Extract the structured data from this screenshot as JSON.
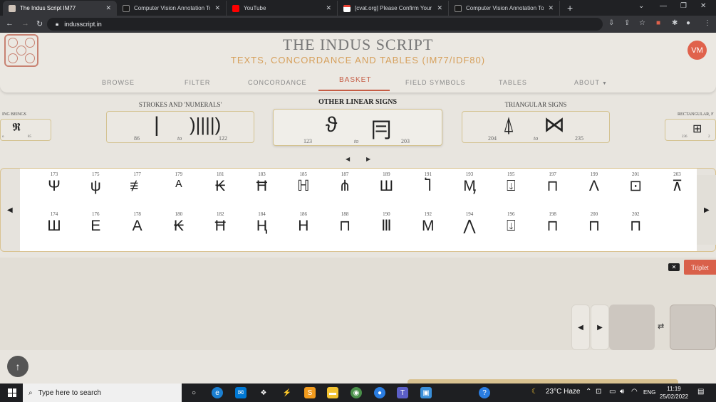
{
  "browser": {
    "tabs": [
      {
        "title": "The Indus Script IM77",
        "active": true,
        "favicon_color": "#cfc3b8"
      },
      {
        "title": "Computer Vision Annotation Too",
        "active": false,
        "favicon_color": "#1a1a1a"
      },
      {
        "title": "YouTube",
        "active": false,
        "favicon_color": "#ff0000"
      },
      {
        "title": "[cvat.org] Please Confirm Your E-",
        "active": false,
        "favicon_color": "#ffffff"
      },
      {
        "title": "Computer Vision Annotation Too",
        "active": false,
        "favicon_color": "#1a1a1a"
      }
    ],
    "close_glyph": "✕",
    "new_tab_glyph": "+",
    "url": "indusscript.in"
  },
  "site": {
    "title": "THE INDUS SCRIPT",
    "subtitle": "TEXTS, CONCORDANCE AND TABLES (IM77/IDF80)",
    "avatar_initials": "VM",
    "menu": [
      "BROWSE",
      "FILTER",
      "CONCORDANCE",
      "BASKET",
      "FIELD SYMBOLS",
      "TABLES",
      "ABOUT"
    ],
    "active_menu": "BASKET",
    "accent": "#c55c44"
  },
  "categories": {
    "left_partial": {
      "title": "ING BEINGS",
      "from": "o",
      "to": "85"
    },
    "strokes": {
      "title": "STROKES AND 'NUMERALS'",
      "from": "86",
      "to_word": "to",
      "to": "122"
    },
    "linear": {
      "title": "OTHER LINEAR SIGNS",
      "from": "123",
      "to_word": "to",
      "to": "203"
    },
    "triangular": {
      "title": "TRIANGULAR SIGNS",
      "from": "204",
      "to_word": "to",
      "to": "235"
    },
    "right_partial": {
      "title": "RECTANGULAR, F",
      "from": "236",
      "to": "2"
    }
  },
  "signs_top": [
    "173",
    "175",
    "177",
    "179",
    "181",
    "183",
    "185",
    "187",
    "189",
    "191",
    "193",
    "195",
    "197",
    "199",
    "201",
    "203"
  ],
  "signs_bottom": [
    "174",
    "176",
    "178",
    "180",
    "182",
    "184",
    "186",
    "188",
    "190",
    "192",
    "194",
    "196",
    "198",
    "200",
    "202"
  ],
  "glyphs_top": [
    "Ψ",
    "ψ",
    "≢",
    "ᴬ",
    "₭",
    "Ħ",
    "ℍ",
    "⋔",
    "Ш",
    "Ⴈ",
    "Ӎ",
    "⍗",
    "⊓",
    "Ʌ",
    "⊡",
    "⊼"
  ],
  "glyphs_bottom": [
    "Ш",
    "E",
    "A",
    "₭",
    "Ħ",
    "Ⱨ",
    "H",
    "⊓",
    "Ⅲ",
    "M",
    "⋀",
    "⍗",
    "⊓",
    "⊓",
    "⊓"
  ],
  "basket": {
    "triplet_label": "Triplet"
  },
  "taskbar": {
    "search_placeholder": "Type here to search",
    "weather": "23°C  Haze",
    "language": "ENG",
    "time": "11:19",
    "date": "25/02/2022"
  }
}
